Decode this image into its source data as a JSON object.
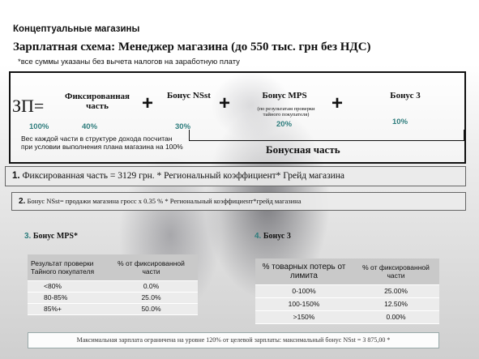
{
  "header": {
    "section_title": "Концептуальные магазины",
    "scheme_title": "Зарплатная схема: Менеджер магазина (до 550 тыс. грн без НДС)",
    "note": "*все суммы указаны без вычета налогов на заработную плату"
  },
  "formula": {
    "zp_label": "ЗП=",
    "fixed_label": "Фиксированная часть",
    "fixed_pct": "100%",
    "plus": "+",
    "nsst_label": "Бонус NSst",
    "nsst_pct": "40%",
    "mps_label": "Бонус MPS",
    "mps_pct": "30%",
    "mps_note": "(по результатам проверки тайного покупателя)",
    "mps_pct2": "20%",
    "bonus3_label": "Бонус 3",
    "bonus3_pct": "10%",
    "weight_text": "Вес каждой части в структуре дохода посчитан при условии выполнения плана магазина на 100%",
    "bonus_part": "Бонусная часть"
  },
  "rows": {
    "r1_num": "1.",
    "r1_text": " Фиксированная часть = 3129 грн. * Региональный коэффициент* Грейд магазина",
    "r2_num": "2.",
    "r2_text": " Бонус NSst= продажи магазина гросс х 0.35 % * Региональный коэффициент*грейд магазина"
  },
  "sections": {
    "s3_num": "3.",
    "s3_label": "Бонус MPS*",
    "s4_num": "4.",
    "s4_label": "Бонус 3"
  },
  "table_mps": {
    "headers": [
      "Результат проверки Тайного покупателя",
      "% от фиксированной части"
    ],
    "rows": [
      [
        "<80%",
        "0.0%"
      ],
      [
        "80-85%",
        "25.0%"
      ],
      [
        "85%+",
        "50.0%"
      ]
    ]
  },
  "table_loss": {
    "headers": [
      "% товарных потерь от лимита",
      "% от фиксированной части"
    ],
    "rows": [
      [
        "0-100%",
        "25.00%"
      ],
      [
        "100-150%",
        "12.50%"
      ],
      [
        ">150%",
        "0.00%"
      ]
    ]
  },
  "footer": {
    "text": "Максимальная зарплата ограничена на уровне 120% от целевой зарплаты: максимальный бонус NSst = 3 875,00 *"
  }
}
